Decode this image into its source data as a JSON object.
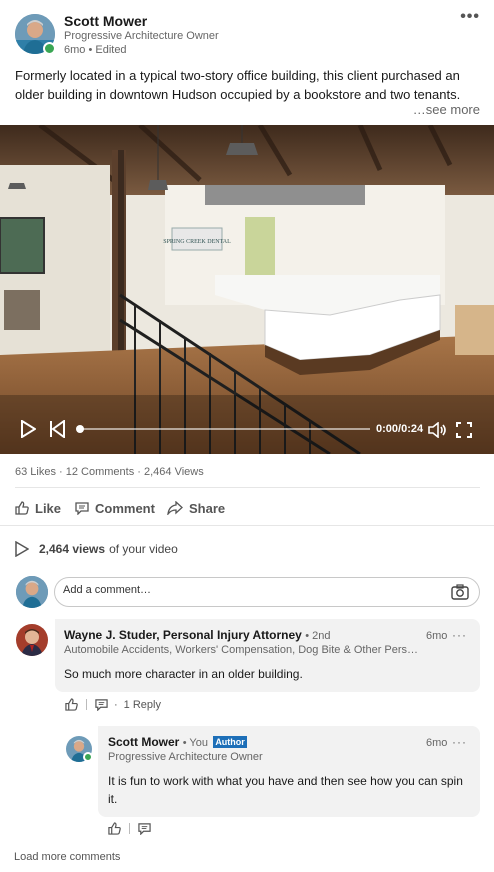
{
  "post": {
    "author_name": "Scott Mower",
    "author_headline": "Progressive Architecture Owner",
    "meta": "6mo • Edited",
    "more_menu": "•••",
    "text": "Formerly located in a typical two-story office building, this client purchased an older building in downtown Hudson occupied by a bookstore and two tenants.",
    "see_more": "…see more"
  },
  "video": {
    "sign_text": "SPRING CREEK DENTAL",
    "time": "0:00/0:24",
    "progress": 0.0,
    "icons": [
      "play-icon",
      "rewind-icon",
      "volume-icon",
      "fullscreen-icon"
    ]
  },
  "social": {
    "counts": "63 Likes · 12 Comments · 2,464 Views",
    "actions": [
      {
        "label": "Like",
        "icon": "like-icon"
      },
      {
        "label": "Comment",
        "icon": "comment-icon"
      },
      {
        "label": "Share",
        "icon": "share-icon"
      }
    ]
  },
  "views": {
    "count": "2,464 views",
    "suffix": "of your video"
  },
  "comment_input": {
    "placeholder": "Add a comment…",
    "icon": "camera-icon"
  },
  "comments": [
    {
      "name": "Wayne J. Studer, Personal Injury Attorney",
      "degree": "• 2nd",
      "headline": "Automobile Accidents, Workers' Compensation, Dog Bite & Other Pers…",
      "time": "6mo",
      "text": "So much more character in an older building.",
      "reply_count": "1 Reply",
      "replies": [
        {
          "name": "Scott Mower",
          "you": "• You",
          "badge": "Author",
          "headline": "Progressive Architecture Owner",
          "time": "6mo",
          "text": "It is fun to work with what you have and then see how you can spin it."
        }
      ]
    }
  ],
  "load_more": "Load more comments",
  "colors": {
    "brand_blue": "#1d6fb8",
    "presence_green": "#3aa654",
    "bubble_bg": "#f2f2f2"
  }
}
